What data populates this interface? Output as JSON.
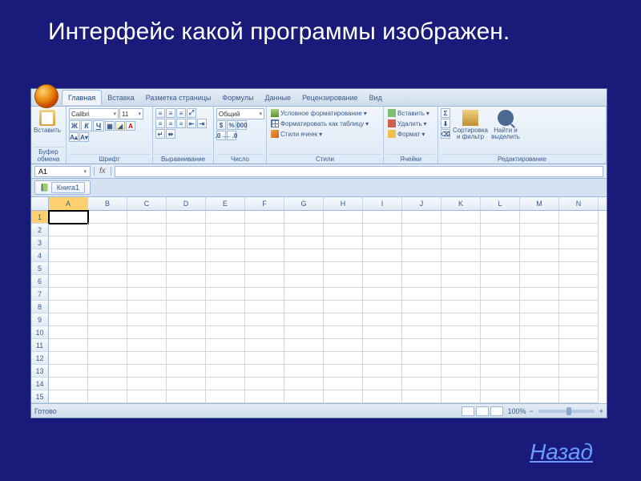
{
  "slide": {
    "question": "Интерфейс какой программы изображен.",
    "back_link": "Назад"
  },
  "ribbon": {
    "tabs": [
      "Главная",
      "Вставка",
      "Разметка страницы",
      "Формулы",
      "Данные",
      "Рецензирование",
      "Вид"
    ],
    "active_tab": 0,
    "clipboard": {
      "paste": "Вставить",
      "label": "Буфер обмена"
    },
    "font": {
      "name": "Calibri",
      "size": "11",
      "label": "Шрифт"
    },
    "align": {
      "label": "Выравнивание"
    },
    "number": {
      "format": "Общий",
      "label": "Число"
    },
    "styles": {
      "cond": "Условное форматирование",
      "table": "Форматировать как таблицу",
      "cell": "Стили ячеек",
      "label": "Стили"
    },
    "cells": {
      "insert": "Вставить",
      "delete": "Удалить",
      "format": "Формат",
      "label": "Ячейки"
    },
    "editing": {
      "sort": "Сортировка и фильтр",
      "find": "Найти и выделить",
      "label": "Редактирование"
    }
  },
  "formula": {
    "cell_ref": "A1",
    "fx": "fx"
  },
  "doc": {
    "name": "Книга1"
  },
  "grid": {
    "columns": [
      "A",
      "B",
      "C",
      "D",
      "E",
      "F",
      "G",
      "H",
      "I",
      "J",
      "K",
      "L",
      "M",
      "N"
    ],
    "rows": [
      1,
      2,
      3,
      4,
      5,
      6,
      7,
      8,
      9,
      10,
      11,
      12,
      13,
      14,
      15
    ],
    "active": {
      "row": 1,
      "col": "A"
    }
  },
  "status": {
    "ready": "Готово",
    "zoom": "100%"
  }
}
